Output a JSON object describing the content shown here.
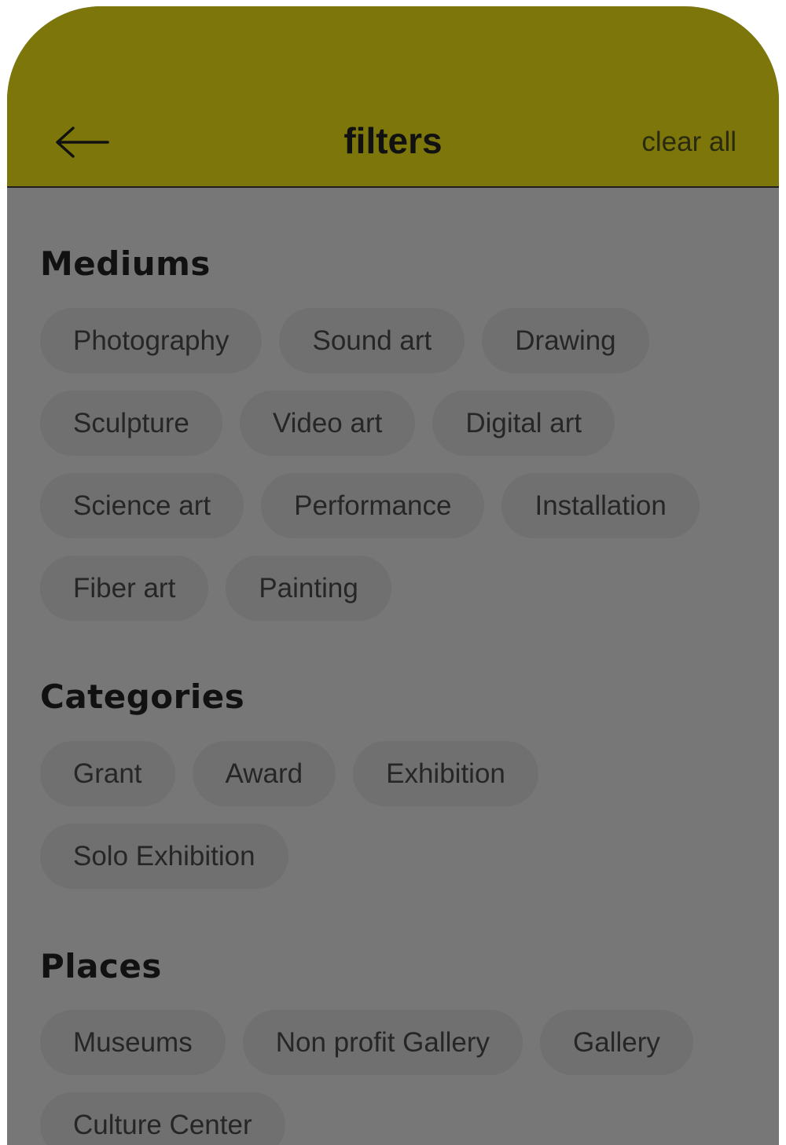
{
  "header": {
    "title": "filters",
    "clear_label": "clear all",
    "back_icon": "arrow-left-icon",
    "background": "#7d770b"
  },
  "sections": [
    {
      "title": "Mediums",
      "chips": [
        "Photography",
        "Sound art",
        "Drawing",
        "Sculpture",
        "Video art",
        "Digital art",
        "Science art",
        "Performance",
        "Installation",
        "Fiber art",
        "Painting"
      ]
    },
    {
      "title": "Categories",
      "chips": [
        "Grant",
        "Award",
        "Exhibition",
        "Solo Exhibition"
      ]
    },
    {
      "title": "Places",
      "chips": [
        "Museums",
        "Non profit Gallery",
        "Gallery",
        "Culture Center"
      ]
    }
  ],
  "colors": {
    "content_background": "#777777",
    "chip_background": "#707070",
    "chip_text": "#262626"
  }
}
